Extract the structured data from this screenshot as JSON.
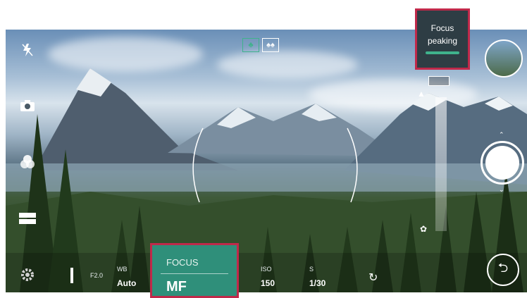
{
  "camera": {
    "mode_icons": [
      "tree-icon",
      "trees-icon"
    ],
    "left_toolbar": [
      "flash-off-icon",
      "camera-switch-icon",
      "filter-icon",
      "grid-icon",
      "settings-icon"
    ],
    "focus_peaking": {
      "line1": "Focus",
      "line2": "peaking"
    },
    "focus_panel": {
      "label": "FOCUS",
      "value": "MF"
    },
    "manual_settings": {
      "aperture": "F2.0",
      "wb_label": "WB",
      "wb_value": "Auto",
      "iso_label": "ISO",
      "iso_value": "150",
      "s_label": "S",
      "s_value": "1/30"
    },
    "colors": {
      "highlight_border": "#c0294a",
      "focus_bg": "#2f8f7a",
      "peaking_bar": "#3fb28c"
    }
  }
}
